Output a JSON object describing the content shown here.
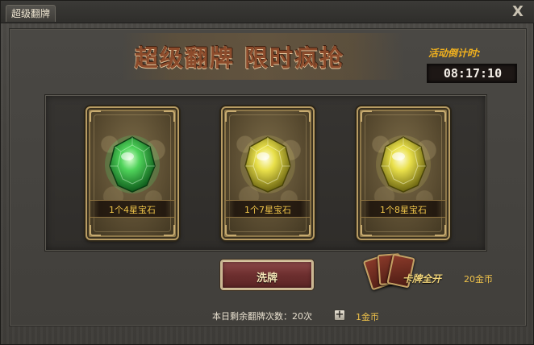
{
  "window": {
    "title_tab": "超级翻牌",
    "close_label": "X"
  },
  "banner": {
    "title": "超级翻牌 限时疯抢",
    "countdown_label": "活动倒计时:",
    "countdown_value": "08:17:10"
  },
  "cards": [
    {
      "label": "1个4星宝石",
      "gem": "green-gem-icon",
      "color": "#2fb24a"
    },
    {
      "label": "1个7星宝石",
      "gem": "yellow-gem-icon",
      "color": "#d9cf3a"
    },
    {
      "label": "1个8星宝石",
      "gem": "yellow-gem-icon",
      "color": "#d9cf3a"
    }
  ],
  "actions": {
    "shuffle_label": "洗牌",
    "open_all_label": "卡牌全开",
    "open_all_price": "20金币"
  },
  "footer": {
    "remaining_text": "本日剩余翻牌次数：20次",
    "plus_label": "+",
    "plus_price": "1金币"
  },
  "colors": {
    "accent_gold": "#efc24a",
    "banner_title": "#8c4b2b",
    "button_red": "#6d2f2f"
  }
}
